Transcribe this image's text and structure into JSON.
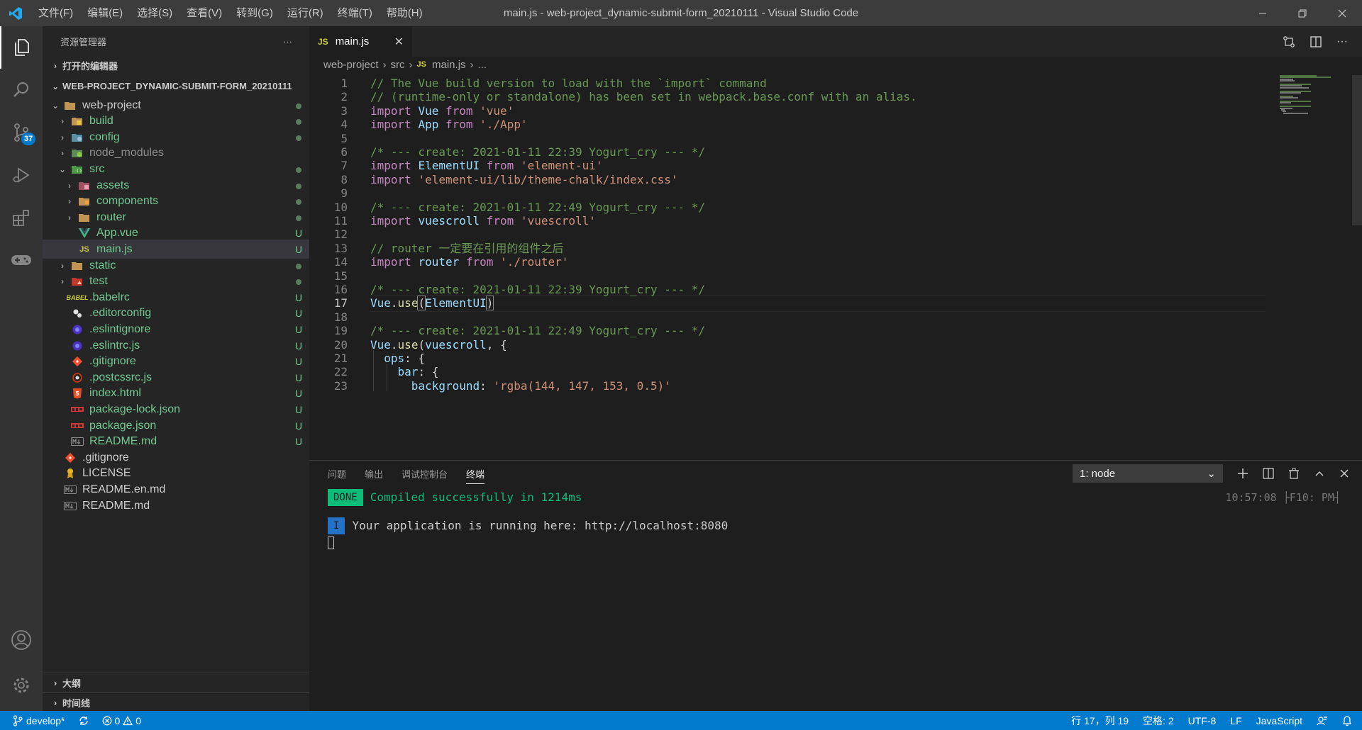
{
  "window": {
    "title": "main.js - web-project_dynamic-submit-form_20210111 - Visual Studio Code",
    "menu": [
      "文件(F)",
      "编辑(E)",
      "选择(S)",
      "查看(V)",
      "转到(G)",
      "运行(R)",
      "终端(T)",
      "帮助(H)"
    ]
  },
  "activity": {
    "scm_badge": "37"
  },
  "sidebar": {
    "title": "资源管理器",
    "more": "···",
    "open_editors": "打开的编辑器",
    "root": "WEB-PROJECT_DYNAMIC-SUBMIT-FORM_20210111",
    "items": [
      {
        "name": "web-project",
        "status": "dot"
      },
      {
        "name": "build",
        "status": "dot"
      },
      {
        "name": "config",
        "status": "dot"
      },
      {
        "name": "node_modules",
        "status": ""
      },
      {
        "name": "src",
        "status": "dot"
      },
      {
        "name": "assets",
        "status": "dot"
      },
      {
        "name": "components",
        "status": "dot"
      },
      {
        "name": "router",
        "status": "dot"
      },
      {
        "name": "App.vue",
        "status": "U"
      },
      {
        "name": "main.js",
        "status": "U"
      },
      {
        "name": "static",
        "status": "dot"
      },
      {
        "name": "test",
        "status": "dot"
      },
      {
        "name": ".babelrc",
        "status": "U"
      },
      {
        "name": ".editorconfig",
        "status": "U"
      },
      {
        "name": ".eslintignore",
        "status": "U"
      },
      {
        "name": ".eslintrc.js",
        "status": "U"
      },
      {
        "name": ".gitignore",
        "status": "U"
      },
      {
        "name": ".postcssrc.js",
        "status": "U"
      },
      {
        "name": "index.html",
        "status": "U"
      },
      {
        "name": "package-lock.json",
        "status": "U"
      },
      {
        "name": "package.json",
        "status": "U"
      },
      {
        "name": "README.md",
        "status": "U"
      },
      {
        "name": ".gitignore",
        "status": ""
      },
      {
        "name": "LICENSE",
        "status": ""
      },
      {
        "name": "README.en.md",
        "status": ""
      },
      {
        "name": "README.md",
        "status": ""
      }
    ],
    "outline": "大纲",
    "timeline": "时间线"
  },
  "editor": {
    "tab_label": "main.js",
    "tab_icon": "JS",
    "breadcrumb": [
      "web-project",
      "src",
      "main.js",
      "..."
    ],
    "lines": [
      "// The Vue build version to load with the `import` command",
      "// (runtime-only or standalone) has been set in webpack.base.conf with an alias.",
      "import Vue from 'vue'",
      "import App from './App'",
      "",
      "/* --- create: 2021-01-11 22:39 Yogurt_cry --- */",
      "import ElementUI from 'element-ui'",
      "import 'element-ui/lib/theme-chalk/index.css'",
      "",
      "/* --- create: 2021-01-11 22:49 Yogurt_cry --- */",
      "import vuescroll from 'vuescroll'",
      "",
      "// router 一定要在引用的组件之后",
      "import router from './router'",
      "",
      "/* --- create: 2021-01-11 22:39 Yogurt_cry --- */",
      "Vue.use(ElementUI)",
      "",
      "/* --- create: 2021-01-11 22:49 Yogurt_cry --- */",
      "Vue.use(vuescroll, {",
      "  ops: {",
      "    bar: {",
      "      background: 'rgba(144, 147, 153, 0.5)'"
    ],
    "current_line": 17
  },
  "panel": {
    "tabs": [
      "问题",
      "输出",
      "调试控制台",
      "终端"
    ],
    "active_tab": "终端",
    "terminal_select": "1: node",
    "done_label": "DONE",
    "done_text": "Compiled successfully in 1214ms",
    "info_label": "I",
    "info_text": "Your application is running here: http://localhost:8080",
    "time_text": "10:57:08 ├F10: PM┤"
  },
  "statusbar": {
    "branch": "develop*",
    "errors": "0",
    "warnings": "0",
    "position": "行 17，列 19",
    "spaces": "空格: 2",
    "encoding": "UTF-8",
    "eol": "LF",
    "language": "JavaScript"
  },
  "colors": {
    "accent": "#007acc",
    "untracked": "#73c991",
    "comment": "#6a9955",
    "keyword": "#c586c0",
    "string": "#ce9178",
    "variable": "#9cdcfe"
  }
}
